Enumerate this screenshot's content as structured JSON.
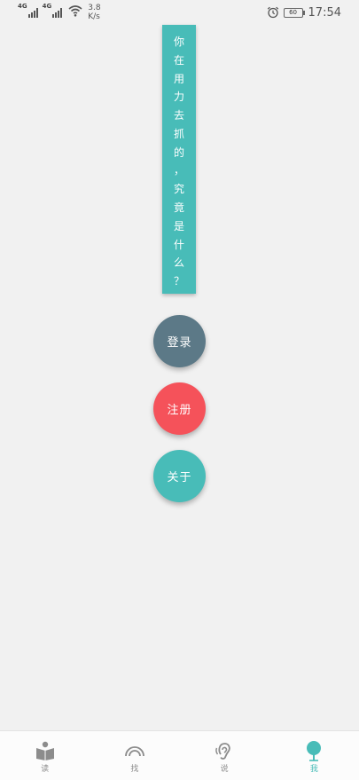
{
  "status_bar": {
    "signal1_label": "4G",
    "signal2_label": "4G",
    "speed_value": "3.8",
    "speed_unit": "K/s",
    "battery": "60",
    "time": "17:54"
  },
  "quote": {
    "characters": [
      "你",
      "在",
      "用",
      "力",
      "去",
      "抓",
      "的",
      "，",
      "究",
      "竟",
      "是",
      "什",
      "么",
      "？"
    ]
  },
  "buttons": {
    "login": "登录",
    "register": "注册",
    "about": "关于"
  },
  "nav": {
    "items": [
      {
        "label": "读",
        "icon": "book-reader-icon",
        "active": false
      },
      {
        "label": "找",
        "icon": "arc-signal-icon",
        "active": false
      },
      {
        "label": "说",
        "icon": "ear-icon",
        "active": false
      },
      {
        "label": "我",
        "icon": "tree-icon",
        "active": true
      }
    ]
  },
  "colors": {
    "background": "#f1f1f1",
    "accent": "#48bcb8",
    "login": "#5c7987",
    "register": "#f5525a",
    "nav_inactive": "#8c8c8c"
  }
}
